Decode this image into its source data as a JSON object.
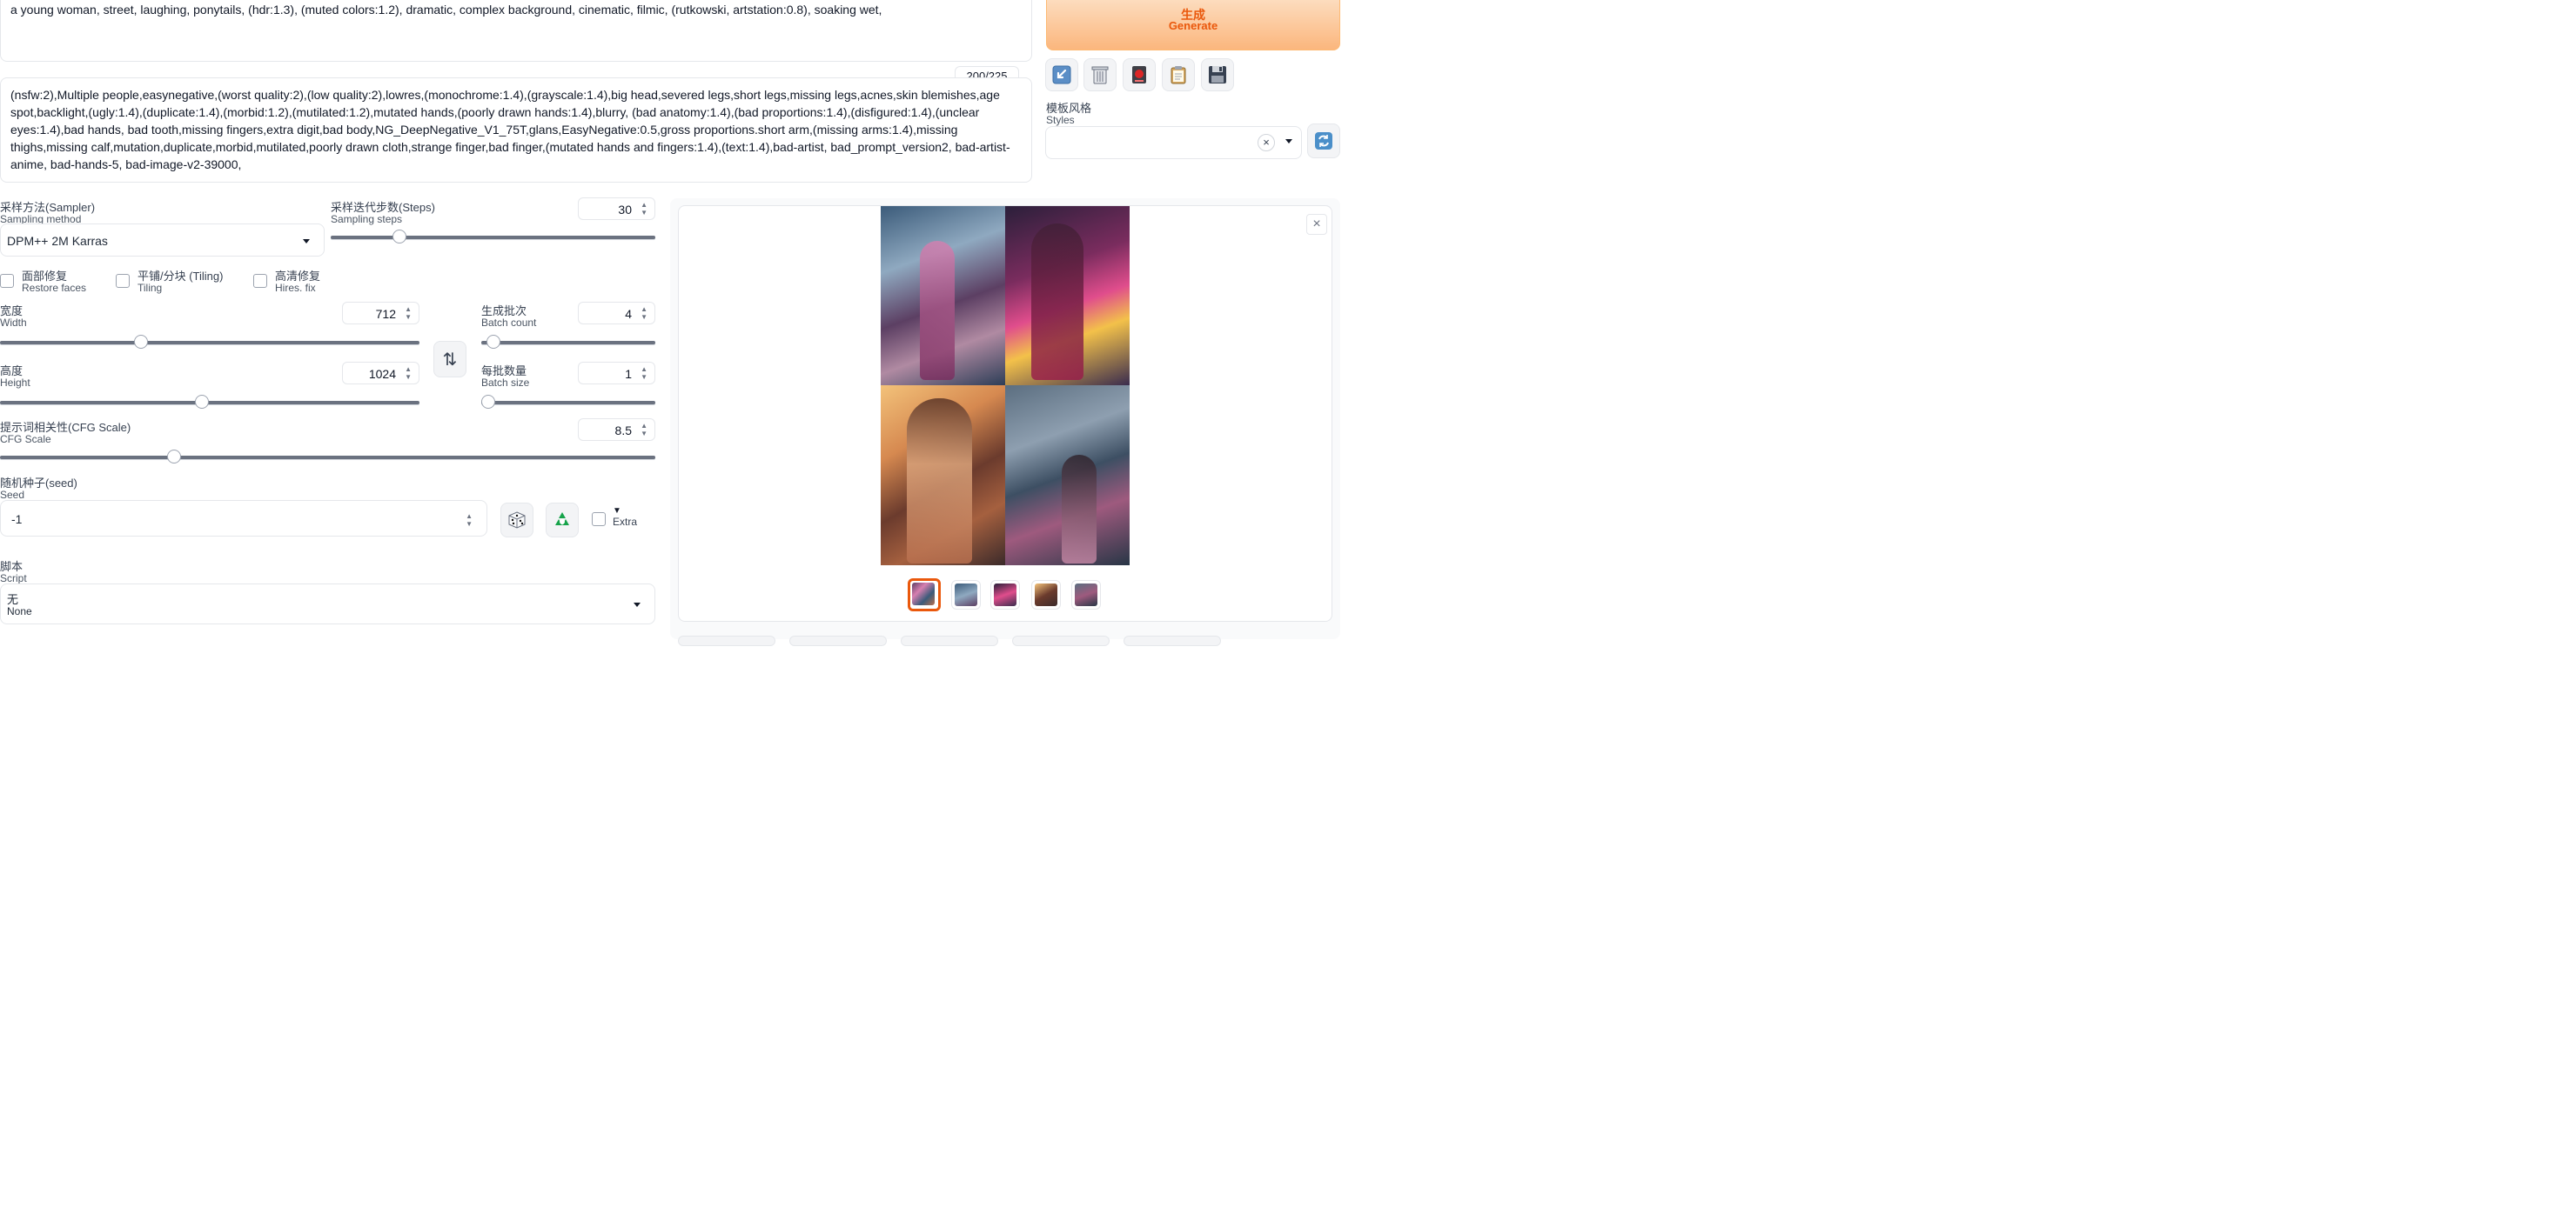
{
  "prompt": {
    "positive_text": "a young woman, street, laughing, ponytails, (hdr:1.3), (muted colors:1.2), dramatic, complex background, cinematic, filmic, (rutkowski, artstation:0.8), soaking wet,",
    "token_counter": "200/225",
    "negative_text": "(nsfw:2),Multiple people,easynegative,(worst quality:2),(low quality:2),lowres,(monochrome:1.4),(grayscale:1.4),big head,severed legs,short legs,missing legs,acnes,skin blemishes,age spot,backlight,(ugly:1.4),(duplicate:1.4),(morbid:1.2),(mutilated:1.2),mutated hands,(poorly drawn hands:1.4),blurry, (bad anatomy:1.4),(bad proportions:1.4),(disfigured:1.4),(unclear eyes:1.4),bad hands, bad tooth,missing fingers,extra digit,bad body,NG_DeepNegative_V1_75T,glans,EasyNegative:0.5,gross proportions.short arm,(missing arms:1.4),missing thighs,missing calf,mutation,duplicate,morbid,mutilated,poorly drawn cloth,strange finger,bad finger,(mutated hands and fingers:1.4),(text:1.4),bad-artist, bad_prompt_version2, bad-artist-anime, bad-hands-5, bad-image-v2-39000,"
  },
  "generate": {
    "label_cn": "生成",
    "label_en": "Generate"
  },
  "tools": {
    "icons": [
      "arrow-in-box-icon",
      "trash-icon",
      "red-card-icon",
      "clipboard-icon",
      "save-icon"
    ]
  },
  "styles": {
    "label_cn": "模板风格",
    "label_en": "Styles",
    "value": "",
    "clear": "×",
    "refresh_icon": "refresh-icon"
  },
  "sampler": {
    "label_cn": "采样方法(Sampler)",
    "label_en": "Sampling method",
    "value": "DPM++ 2M Karras"
  },
  "steps": {
    "label_cn": "采样迭代步数(Steps)",
    "label_en": "Sampling steps",
    "value": "30",
    "fraction": 0.2
  },
  "checks": [
    {
      "cn": "面部修复",
      "en": "Restore faces",
      "checked": false
    },
    {
      "cn": "平铺/分块 (Tiling)",
      "en": "Tiling",
      "checked": false
    },
    {
      "cn": "高清修复",
      "en": "Hires. fix",
      "checked": false
    }
  ],
  "width": {
    "label_cn": "宽度",
    "label_en": "Width",
    "value": "712",
    "fraction": 0.33
  },
  "height": {
    "label_cn": "高度",
    "label_en": "Height",
    "value": "1024",
    "fraction": 0.48
  },
  "batch_count": {
    "label_cn": "生成批次",
    "label_en": "Batch count",
    "value": "4",
    "fraction": 0.03
  },
  "batch_size": {
    "label_cn": "每批数量",
    "label_en": "Batch size",
    "value": "1",
    "fraction": 0.0
  },
  "cfg": {
    "label_cn": "提示词相关性(CFG Scale)",
    "label_en": "CFG Scale",
    "value": "8.5",
    "fraction": 0.26
  },
  "seed": {
    "label_cn": "随机种子(seed)",
    "label_en": "Seed",
    "value": "-1",
    "extra_label": "Extra",
    "extra_arrow": "▼"
  },
  "script": {
    "label_cn": "脚本",
    "label_en": "Script",
    "value_cn": "无",
    "value_en": "None"
  },
  "swap_icon": "⇅",
  "close": "×",
  "thumbnails_count": 5,
  "colors": {
    "accent": "#ea580c",
    "generate_bg": "#fbbf85"
  }
}
